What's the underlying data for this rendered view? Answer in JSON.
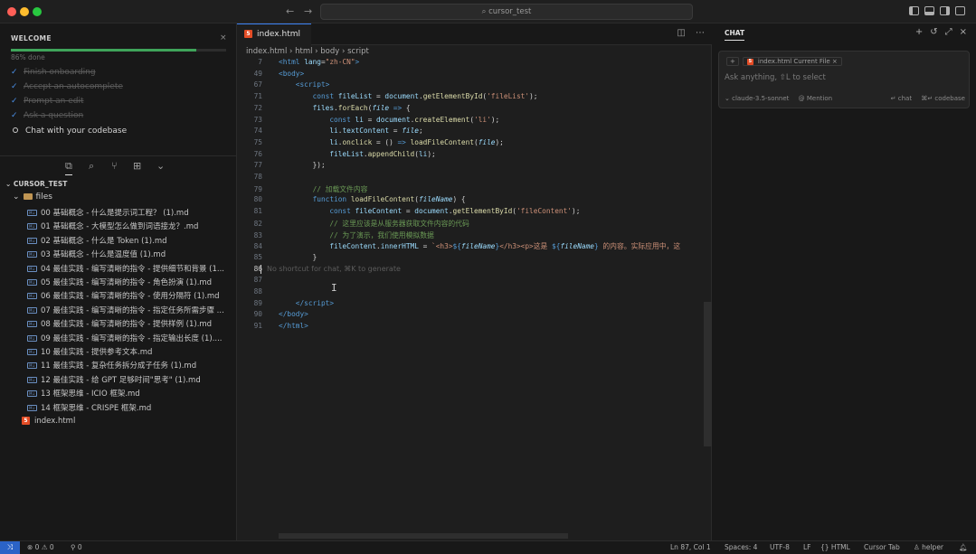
{
  "window": {
    "search_text": "cursor_test",
    "nav_back": "←",
    "nav_forward": "→"
  },
  "welcome": {
    "title": "WELCOME",
    "close": "×",
    "progress_text": "86% done",
    "progress_fraction": 0.86,
    "steps": [
      {
        "label": "Finish onboarding",
        "done": true
      },
      {
        "label": "Accept an autocomplete",
        "done": true
      },
      {
        "label": "Prompt an edit",
        "done": true
      },
      {
        "label": "Ask a question",
        "done": true
      },
      {
        "label": "Chat with your codebase",
        "done": false
      }
    ]
  },
  "explorer": {
    "section": "CURSOR_TEST",
    "folder": "files",
    "files": [
      "00 基础概念 - 什么是提示词工程？ (1).md",
      "01 基础概念 - 大模型怎么做到词语接龙？.md",
      "02 基础概念 - 什么是 Token (1).md",
      "03 基础概念 - 什么是温度值 (1).md",
      "04 最佳实践 - 编写清晰的指令 - 提供细节和背景 (1...",
      "05 最佳实践 - 编写清晰的指令 - 角色扮演 (1).md",
      "06 最佳实践 - 编写清晰的指令 - 使用分隔符 (1).md",
      "07 最佳实践 - 编写清晰的指令 - 指定任务所需步骤 ...",
      "08 最佳实践 - 编写清晰的指令 - 提供样例 (1).md",
      "09 最佳实践 - 编写清晰的指令 - 指定输出长度 (1)....",
      "10 最佳实践 - 提供参考文本.md",
      "11 最佳实践 - 复杂任务拆分成子任务 (1).md",
      "12 最佳实践 - 给 GPT 足够时间\"思考\" (1).md",
      "13 框架思维 - ICIO 框架.md",
      "14 框架思维 - CRISPE 框架.md"
    ],
    "root_file": "index.html"
  },
  "editor": {
    "tab_label": "index.html",
    "breadcrumb": "index.html  ›  html  ›  body  ›  script",
    "ghost_hint": "No shortcut for chat, ⌘K to generate",
    "lines": [
      {
        "n": "7",
        "html": "<span class='tk-tag'>&lt;html</span> <span class='tk-attr'>lang</span><span class='tk-pl'>=</span><span class='tk-str'>\"zh-CN\"</span><span class='tk-tag'>&gt;</span>"
      },
      {
        "n": "49",
        "html": "<span class='tk-tag'>&lt;body&gt;</span>"
      },
      {
        "n": "67",
        "html": "    <span class='tk-tag'>&lt;script&gt;</span>"
      },
      {
        "n": "71",
        "html": "        <span class='tk-kw'>const</span> <span class='tk-var'>fileList</span> <span class='tk-pl'>=</span> <span class='tk-var'>document</span><span class='tk-pl'>.</span><span class='tk-fn'>getElementById</span><span class='tk-pl'>(</span><span class='tk-str'>'fileList'</span><span class='tk-pl'>);</span>"
      },
      {
        "n": "72",
        "html": "        <span class='tk-var'>files</span><span class='tk-pl'>.</span><span class='tk-fn'>forEach</span><span class='tk-pl'>(</span><span class='tk-ital'>file</span> <span class='tk-kw'>=&gt;</span> <span class='tk-pl'>{</span>"
      },
      {
        "n": "73",
        "html": "            <span class='tk-kw'>const</span> <span class='tk-var'>li</span> <span class='tk-pl'>=</span> <span class='tk-var'>document</span><span class='tk-pl'>.</span><span class='tk-fn'>createElement</span><span class='tk-pl'>(</span><span class='tk-str'>'li'</span><span class='tk-pl'>);</span>"
      },
      {
        "n": "74",
        "html": "            <span class='tk-var'>li</span><span class='tk-pl'>.</span><span class='tk-var'>textContent</span> <span class='tk-pl'>=</span> <span class='tk-ital'>file</span><span class='tk-pl'>;</span>"
      },
      {
        "n": "75",
        "html": "            <span class='tk-var'>li</span><span class='tk-pl'>.</span><span class='tk-fn'>onclick</span> <span class='tk-pl'>= ()</span> <span class='tk-kw'>=&gt;</span> <span class='tk-fn'>loadFileContent</span><span class='tk-pl'>(</span><span class='tk-ital'>file</span><span class='tk-pl'>);</span>"
      },
      {
        "n": "76",
        "html": "            <span class='tk-var'>fileList</span><span class='tk-pl'>.</span><span class='tk-fn'>appendChild</span><span class='tk-pl'>(</span><span class='tk-var'>li</span><span class='tk-pl'>);</span>"
      },
      {
        "n": "77",
        "html": "        <span class='tk-pl'>});</span>"
      },
      {
        "n": "78",
        "html": ""
      },
      {
        "n": "79",
        "html": "        <span class='tk-cm'>// 加载文件内容</span>"
      },
      {
        "n": "80",
        "html": "        <span class='tk-kw'>function</span> <span class='tk-fn'>loadFileContent</span><span class='tk-pl'>(</span><span class='tk-ital'>fileName</span><span class='tk-pl'>) {</span>"
      },
      {
        "n": "81",
        "html": "            <span class='tk-kw'>const</span> <span class='tk-var'>fileContent</span> <span class='tk-pl'>=</span> <span class='tk-var'>document</span><span class='tk-pl'>.</span><span class='tk-fn'>getElementById</span><span class='tk-pl'>(</span><span class='tk-str'>'fileContent'</span><span class='tk-pl'>);</span>"
      },
      {
        "n": "82",
        "html": "            <span class='tk-cm'>// 这里应该是从服务器获取文件内容的代码</span>"
      },
      {
        "n": "83",
        "html": "            <span class='tk-cm'>// 为了演示，我们使用模拟数据</span>"
      },
      {
        "n": "84",
        "html": "            <span class='tk-var'>fileContent</span><span class='tk-pl'>.</span><span class='tk-var'>innerHTML</span> <span class='tk-pl'>=</span> <span class='tk-str'>`&lt;h3&gt;</span><span class='tk-kw'>${</span><span class='tk-ital'>fileName</span><span class='tk-kw'>}</span><span class='tk-str'>&lt;/h3&gt;&lt;p&gt;这是 </span><span class='tk-kw'>${</span><span class='tk-ital'>fileName</span><span class='tk-kw'>}</span><span class='tk-str'> 的内容。实际应用中，这</span>"
      },
      {
        "n": "85",
        "html": "        <span class='tk-pl'>}</span>"
      },
      {
        "n": "86",
        "html": "HINT"
      },
      {
        "n": "87",
        "html": ""
      },
      {
        "n": "88",
        "html": ""
      },
      {
        "n": "89",
        "html": "    <span class='tk-tag'>&lt;/script&gt;</span>"
      },
      {
        "n": "90",
        "html": "<span class='tk-tag'>&lt;/body&gt;</span>"
      },
      {
        "n": "91",
        "html": "<span class='tk-tag'>&lt;/html&gt;</span>"
      }
    ],
    "current_line": "86"
  },
  "chat": {
    "title": "CHAT",
    "context_chip": "index.html Current File ×",
    "placeholder": "Ask anything, ⇧L to select",
    "model": "⌄ claude-3.5-sonnet",
    "mention": "@ Mention",
    "chat_btn": "↵ chat",
    "codebase_btn": "⌘↵ codebase"
  },
  "status": {
    "remote": "⤨",
    "problems": "⊗ 0  ⚠ 0",
    "ports": "⚲ 0",
    "position": "Ln 87, Col 1",
    "spaces": "Spaces: 4",
    "encoding": "UTF-8",
    "eol": "LF",
    "language": "{} HTML",
    "tab": "Cursor Tab",
    "helper": "♙ helper",
    "bell": "🔔︎"
  },
  "colors": {
    "accent": "#3b82f6",
    "progress": "#3fa45a",
    "remote_bg": "#2b63c7"
  }
}
